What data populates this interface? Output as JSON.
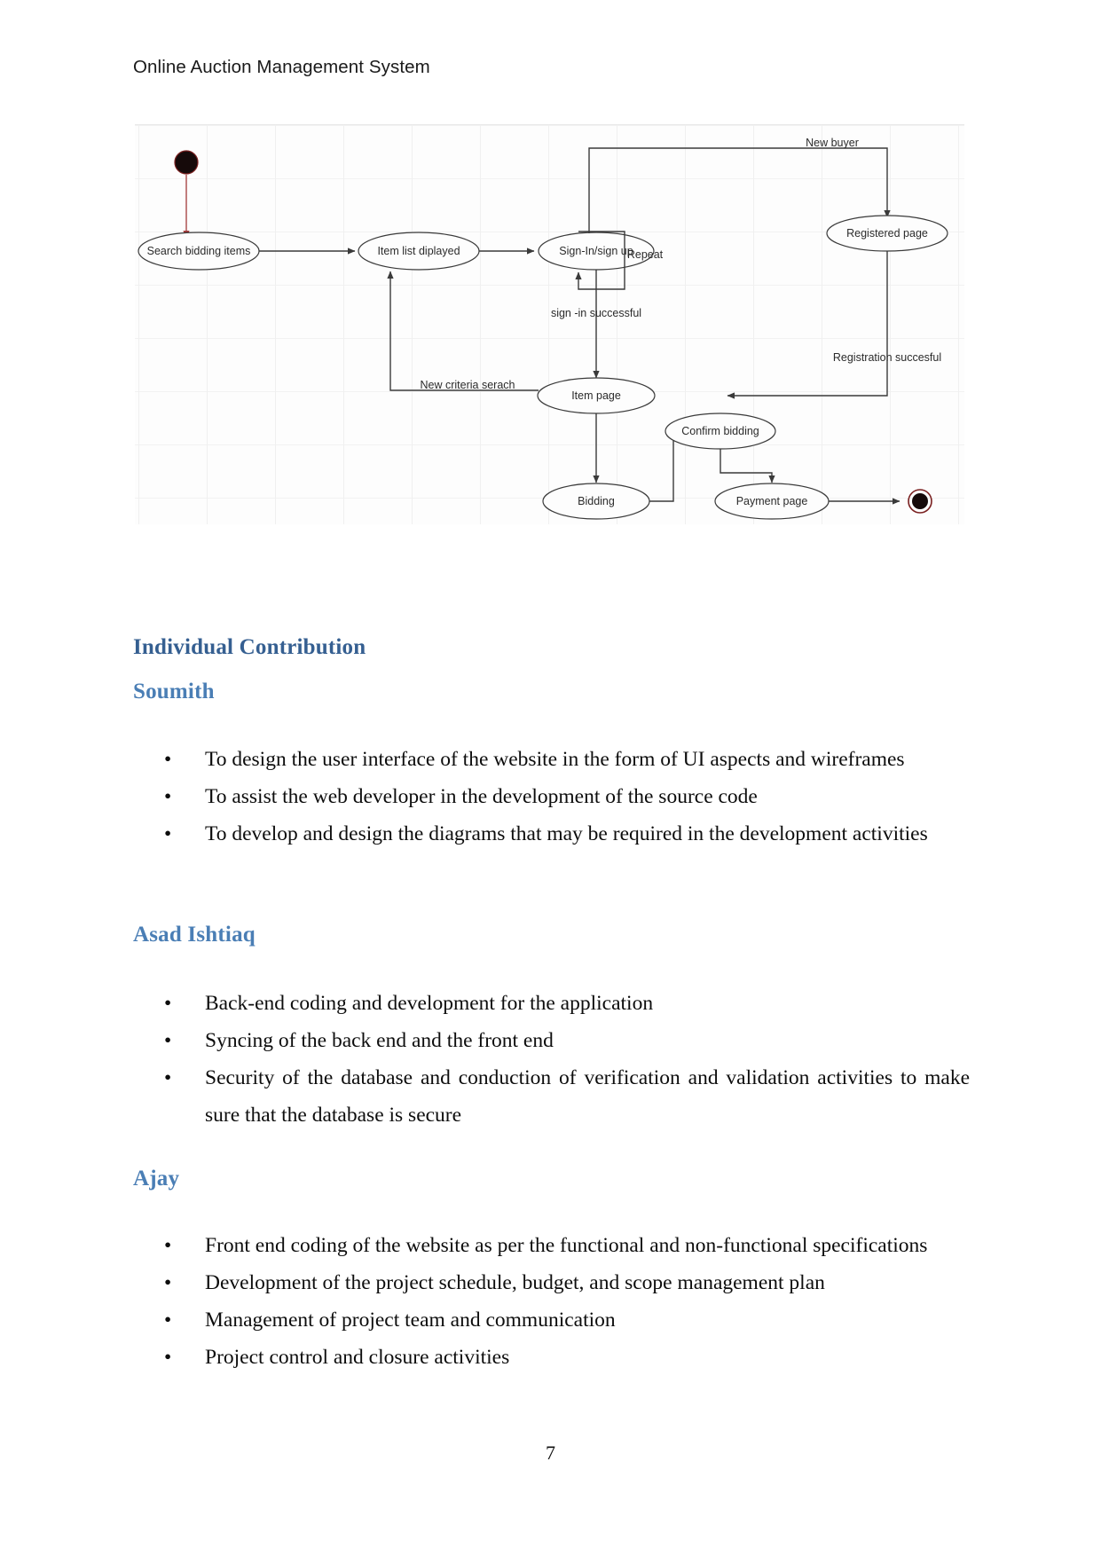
{
  "document": {
    "running_header": "Online Auction Management System",
    "page_number": "7"
  },
  "figure": {
    "caption": "",
    "diagram_type": "uml-activity-diagram",
    "nodes": [
      {
        "id": "start",
        "label": "",
        "shape": "initial-node"
      },
      {
        "id": "search",
        "label": "Search bidding items",
        "shape": "ellipse"
      },
      {
        "id": "itemlist",
        "label": "Item list diplayed",
        "shape": "ellipse"
      },
      {
        "id": "signin",
        "label": "Sign-In/sign up",
        "shape": "ellipse"
      },
      {
        "id": "registered",
        "label": "Registered page",
        "shape": "ellipse"
      },
      {
        "id": "itempage",
        "label": "Item page",
        "shape": "ellipse"
      },
      {
        "id": "confirm",
        "label": "Confirm bidding",
        "shape": "ellipse"
      },
      {
        "id": "bidding",
        "label": "Bidding",
        "shape": "ellipse"
      },
      {
        "id": "payment",
        "label": "Payment page",
        "shape": "ellipse"
      },
      {
        "id": "end",
        "label": "",
        "shape": "final-node"
      }
    ],
    "edge_labels": [
      "New buyer",
      "Repeat",
      "sign -in successful",
      "Registration succesful",
      "New criteria serach"
    ]
  },
  "content": {
    "section_heading": "Individual Contribution",
    "people": [
      {
        "name": "Soumith",
        "bullets": [
          "To design the user interface of the website in the form of UI aspects and wireframes",
          "To assist the web developer in the development of the source code",
          "To develop and design the diagrams that may be required in the development activities"
        ]
      },
      {
        "name": "Asad Ishtiaq",
        "bullets": [
          "Back-end coding and development for the application",
          "Syncing of the back end and the front end",
          "Security of the database and conduction of verification and validation activities to make sure that the database is secure"
        ]
      },
      {
        "name": "Ajay",
        "bullets": [
          "Front end coding of the website as per the functional and non-functional specifications",
          "Development of the project schedule, budget, and scope management plan",
          "Management of project team and communication",
          "Project control and closure activities"
        ]
      }
    ],
    "bullet_glyph": "•"
  },
  "colors": {
    "heading": "#355f91",
    "subheading": "#4a7eb5",
    "body": "#0d0d0d",
    "header": "#1a1a1a"
  }
}
